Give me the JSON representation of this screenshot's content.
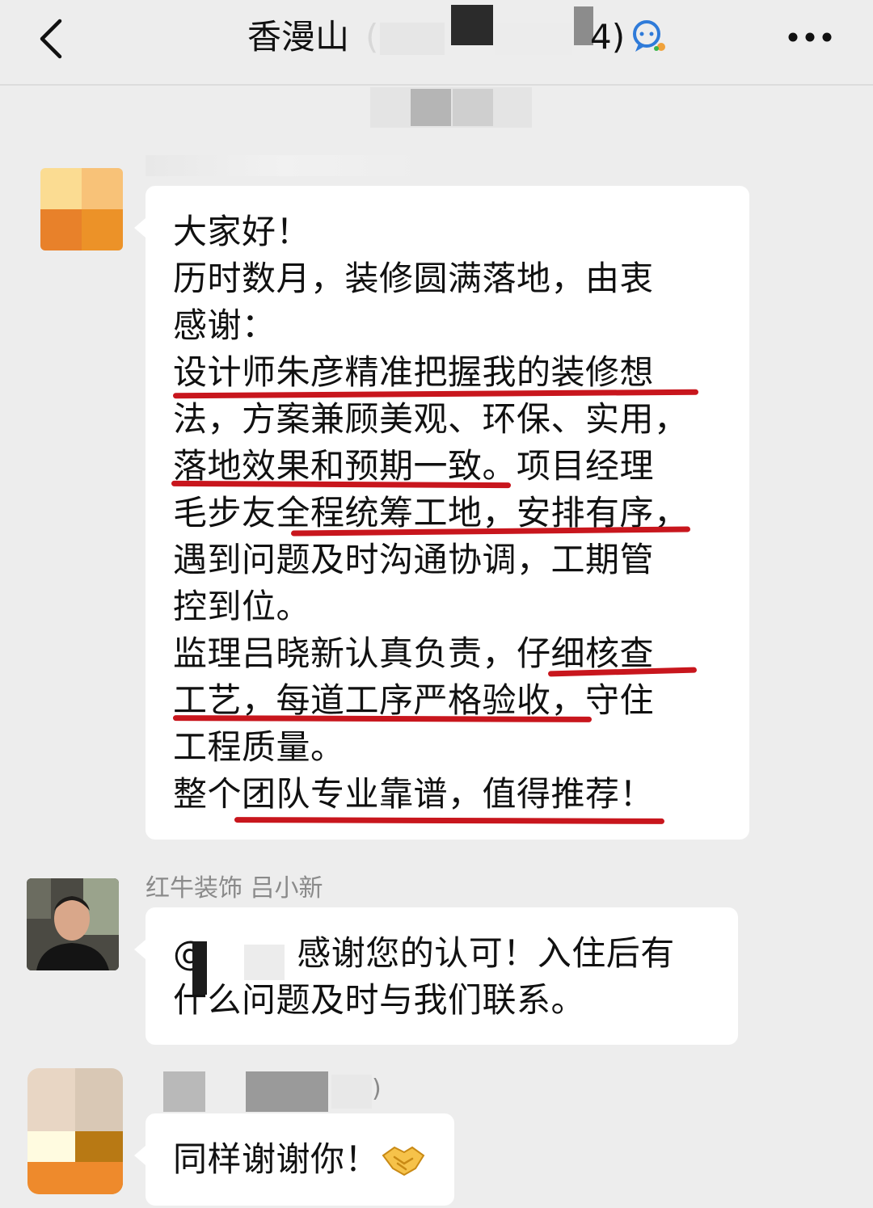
{
  "header": {
    "title": "香漫山",
    "title_paren_open": "(",
    "title_suffix": "4)",
    "back_icon": "chevron-left-icon",
    "group_icon": "group-chat-icon",
    "more_icon": "more-dots-icon"
  },
  "messages": [
    {
      "sender": "",
      "lines": [
        "大家好！",
        "历时数月，装修圆满落地，由衷",
        "感谢：",
        "设计师朱彦精准把握我的装修想",
        "法，方案兼顾美观、环保、实用，",
        "落地效果和预期一致。项目经理",
        "毛步友全程统筹工地，安排有序，",
        "遇到问题及时沟通协调，工期管",
        "控到位。",
        "监理吕晓新认真负责，仔细核查",
        "工艺，每道工序严格验收，守住",
        "工程质量。",
        "整个团队专业靠谱，值得推荐！"
      ]
    },
    {
      "sender": "红牛装饰  吕小新",
      "lines": [
        "@        感谢您的认可！入住后有",
        "什么问题及时与我们联系。"
      ]
    },
    {
      "sender": ")",
      "lines": [
        "同样谢谢你！"
      ],
      "emoji": "handshake-icon"
    }
  ],
  "colors": {
    "background": "#ededed",
    "bubble": "#ffffff",
    "underline": "#c8161d",
    "sender_text": "#8a8a8a"
  }
}
